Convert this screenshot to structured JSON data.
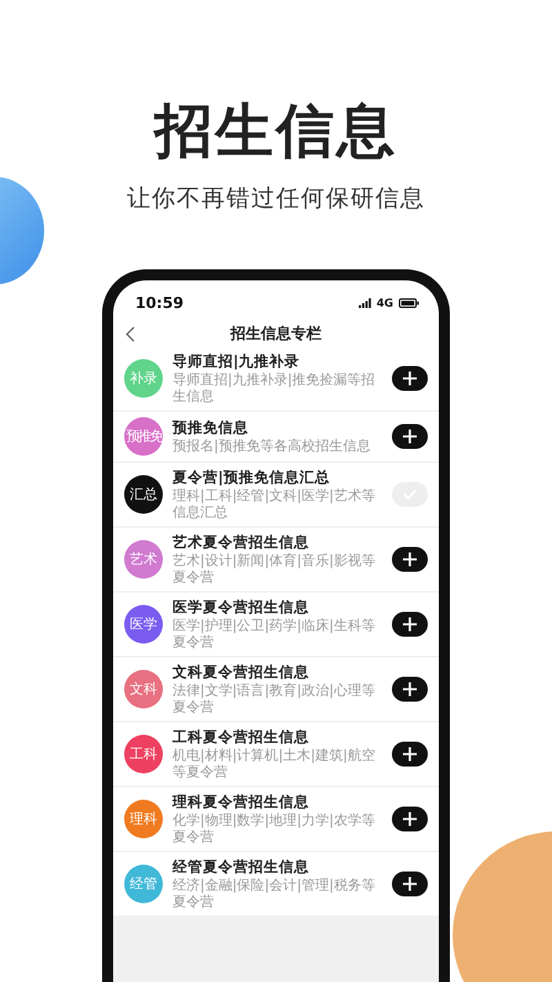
{
  "headline": "招生信息",
  "tagline": "让你不再错过任何保研信息",
  "status_bar": {
    "time": "10:59",
    "network": "4G"
  },
  "nav": {
    "title": "招生信息专栏"
  },
  "items": [
    {
      "badge": "补录",
      "color": "#5fd48a",
      "title": "导师直招|九推补录",
      "subtitle": "导师直招|九推补录|推免捡漏等招生信息",
      "subscribed": false
    },
    {
      "badge": "预推免",
      "color": "#d870c8",
      "title": "预推免信息",
      "subtitle": "预报名|预推免等各高校招生信息",
      "subscribed": false
    },
    {
      "badge": "汇总",
      "color": "#111111",
      "title": "夏令营|预推免信息汇总",
      "subtitle": "理科|工科|经管|文科|医学|艺术等信息汇总",
      "subscribed": true
    },
    {
      "badge": "艺术",
      "color": "#d07ad0",
      "title": "艺术夏令营招生信息",
      "subtitle": "艺术|设计|新闻|体育|音乐|影视等夏令营",
      "subscribed": false
    },
    {
      "badge": "医学",
      "color": "#7a5cf0",
      "title": "医学夏令营招生信息",
      "subtitle": "医学|护理|公卫|药学|临床|生科等夏令营",
      "subscribed": false
    },
    {
      "badge": "文科",
      "color": "#e87080",
      "title": "文科夏令营招生信息",
      "subtitle": "法律|文学|语言|教育|政治|心理等夏令营",
      "subscribed": false
    },
    {
      "badge": "工科",
      "color": "#ee4060",
      "title": "工科夏令营招生信息",
      "subtitle": "机电|材料|计算机|土木|建筑|航空等夏令营",
      "subscribed": false
    },
    {
      "badge": "理科",
      "color": "#f07a20",
      "title": "理科夏令营招生信息",
      "subtitle": "化学|物理|数学|地理|力学|农学等夏令营",
      "subscribed": false
    },
    {
      "badge": "经管",
      "color": "#40b8d8",
      "title": "经管夏令营招生信息",
      "subtitle": "经济|金融|保险|会计|管理|税务等夏令营",
      "subscribed": false
    }
  ]
}
